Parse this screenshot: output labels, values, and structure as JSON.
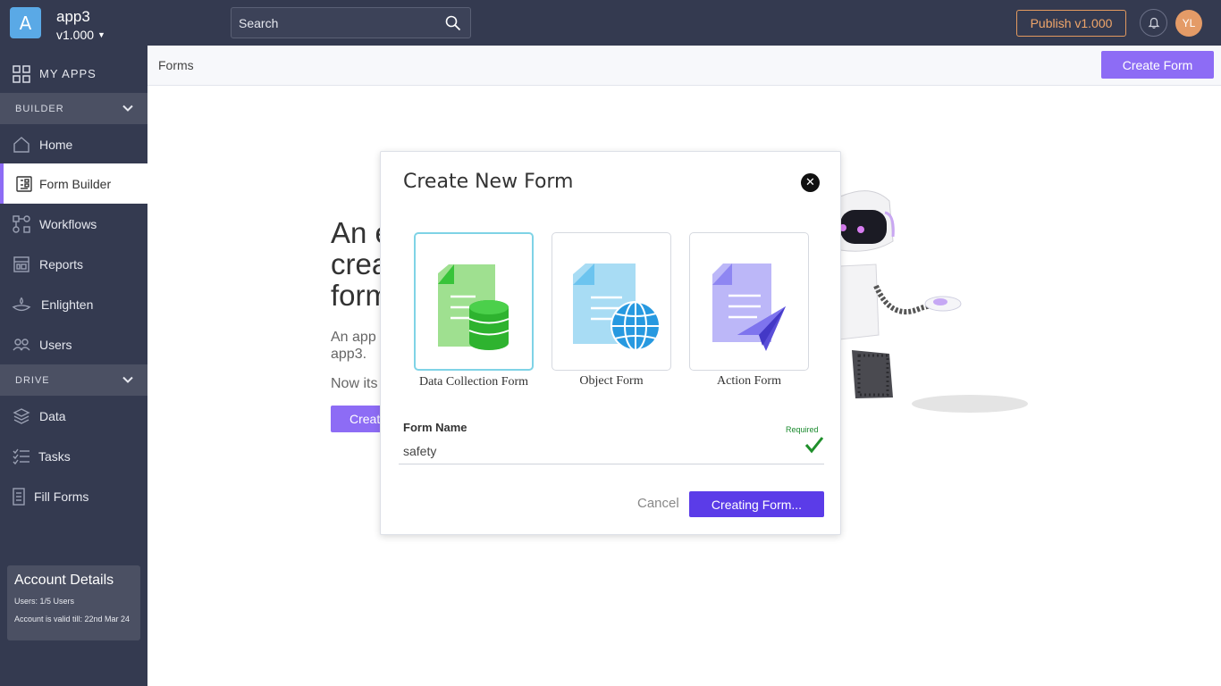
{
  "app": {
    "logo_letter": "A",
    "name": "app3",
    "version": "v1.000"
  },
  "search": {
    "placeholder": "Search"
  },
  "topbar": {
    "publish_label": "Publish v1.000",
    "avatar_initials": "YL"
  },
  "sidebar": {
    "my_apps_label": "MY APPS",
    "builder_section": "BUILDER",
    "drive_section": "DRIVE",
    "items": [
      {
        "label": "Home",
        "icon": "home-icon"
      },
      {
        "label": "Form Builder",
        "icon": "form-builder-icon",
        "active": true
      },
      {
        "label": "Workflows",
        "icon": "workflow-icon"
      },
      {
        "label": "Reports",
        "icon": "reports-icon"
      },
      {
        "label": "Enlighten",
        "icon": "lamp-icon"
      },
      {
        "label": "Users",
        "icon": "users-icon"
      }
    ],
    "drive_items": [
      {
        "label": "Data",
        "icon": "data-icon"
      },
      {
        "label": "Tasks",
        "icon": "tasks-icon"
      },
      {
        "label": "Fill Forms",
        "icon": "fill-forms-icon"
      }
    ],
    "account": {
      "title": "Account Details",
      "users": "Users: 1/5 Users",
      "valid": "Account is valid till: 22nd Mar 24"
    }
  },
  "header": {
    "breadcrumb": "Forms",
    "create_form_label": "Create Form"
  },
  "empty_state": {
    "title": "An e\ncrea\nform",
    "description": "An app\napp3.",
    "now": "Now its",
    "button": "Creat"
  },
  "modal": {
    "title": "Create New Form",
    "form_types": [
      {
        "label": "Data Collection Form",
        "icon": "data-collection-form-icon",
        "selected": true
      },
      {
        "label": "Object Form",
        "icon": "object-form-icon",
        "selected": false
      },
      {
        "label": "Action Form",
        "icon": "action-form-icon",
        "selected": false
      }
    ],
    "field_label": "Form Name",
    "required_label": "Required",
    "field_value": "safety",
    "cancel_label": "Cancel",
    "submit_label": "Creating Form..."
  },
  "colors": {
    "sidebar_bg": "#343a50",
    "accent": "#8d6cf5",
    "primary_button": "#5b3ce8",
    "publish": "#e39a5f"
  }
}
